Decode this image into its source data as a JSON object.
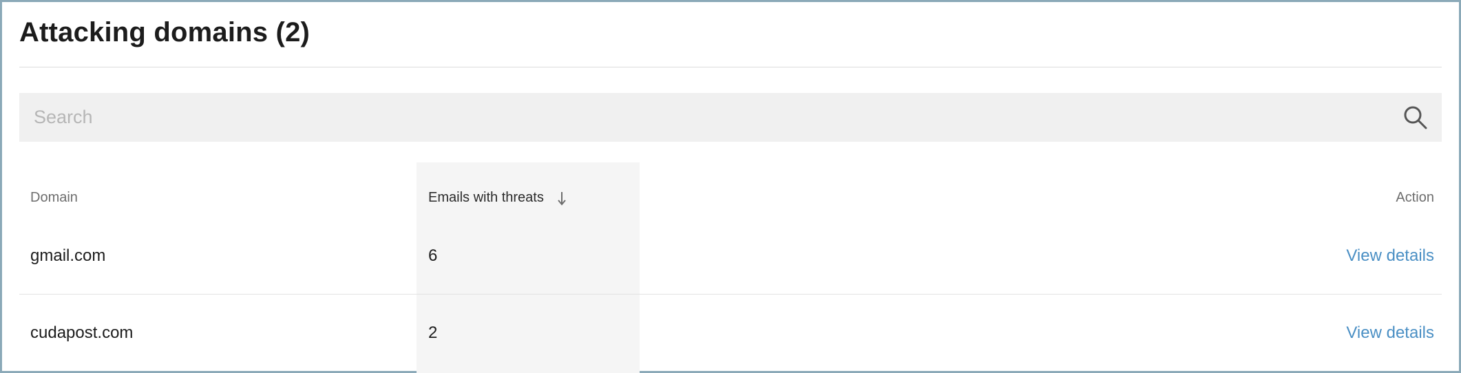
{
  "panel": {
    "title": "Attacking domains (2)"
  },
  "search": {
    "placeholder": "Search",
    "value": "",
    "icon": "search-icon"
  },
  "table": {
    "columns": {
      "domain": "Domain",
      "emails_with_threats": "Emails with threats",
      "action": "Action"
    },
    "sort": {
      "column": "emails_with_threats",
      "direction": "descending",
      "icon": "arrow-down-icon"
    },
    "rows": [
      {
        "domain": "gmail.com",
        "emails_with_threats": "6",
        "action": "View details"
      },
      {
        "domain": "cudapost.com",
        "emails_with_threats": "2",
        "action": "View details"
      }
    ]
  },
  "colors": {
    "title": "#1c1c1c",
    "search_background": "#f0f0f0",
    "sorted_column_background": "#f5f5f5",
    "link": "#4a8fc4",
    "frame_border": "#8ba9b8"
  }
}
